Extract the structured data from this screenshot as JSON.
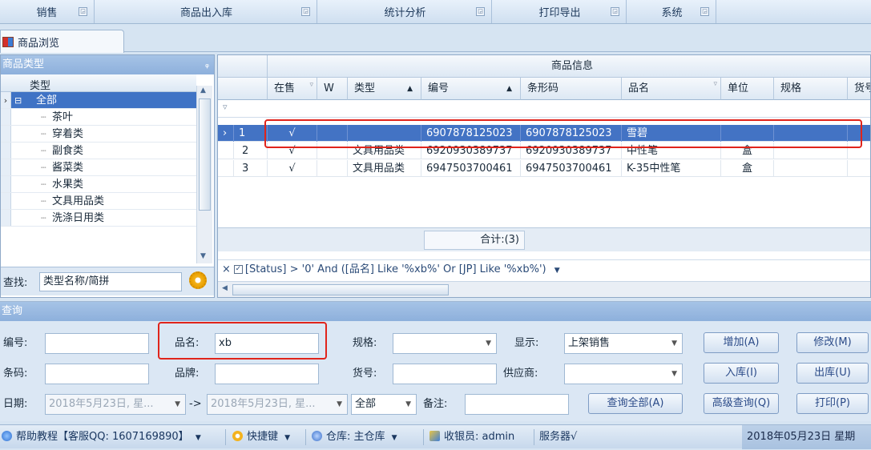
{
  "ribbon": {
    "groups": [
      "销售",
      "商品出入库",
      "统计分析",
      "打印导出",
      "系统"
    ]
  },
  "doc_tab": {
    "label": "商品浏览"
  },
  "category_panel": {
    "title": "商品类型",
    "header": "类型",
    "root": "全部",
    "items": [
      "茶叶",
      "穿着类",
      "副食类",
      "酱菜类",
      "水果类",
      "文具用品类",
      "洗涤日用类"
    ],
    "find_label": "查找:",
    "find_value": "类型名称/简拼"
  },
  "grid": {
    "band_title": "商品信息",
    "columns": [
      "在售",
      "W",
      "类型",
      "编号",
      "条形码",
      "品名",
      "单位",
      "规格",
      "货号"
    ],
    "rows": [
      {
        "no": "1",
        "on_sale": "√",
        "w": "",
        "type": "",
        "code": "6907878125023",
        "barcode": "6907878125023",
        "name": "雪碧",
        "unit": "",
        "spec": ""
      },
      {
        "no": "2",
        "on_sale": "√",
        "w": "",
        "type": "文具用品类",
        "code": "6920930389737",
        "barcode": "6920930389737",
        "name": "中性笔",
        "unit": "盒",
        "spec": ""
      },
      {
        "no": "3",
        "on_sale": "√",
        "w": "",
        "type": "文具用品类",
        "code": "6947503700461",
        "barcode": "6947503700461",
        "name": "K-35中性笔",
        "unit": "盒",
        "spec": ""
      }
    ],
    "total": "合计:(3)",
    "filter_text": "[Status] > '0' And ([品名] Like '%xb%' Or [JP] Like '%xb%')"
  },
  "query": {
    "title": "查询",
    "code_label": "编号:",
    "name_label": "品名:",
    "name_value": "xb",
    "spec_label": "规格:",
    "display_label": "显示:",
    "display_value": "上架销售",
    "barcode_label": "条码:",
    "brand_label": "品牌:",
    "article_label": "货号:",
    "supplier_label": "供应商:",
    "date_label": "日期:",
    "date_from": "2018年5月23日, 星...",
    "arrow": "->",
    "date_to": "2018年5月23日, 星...",
    "range_value": "全部",
    "note_label": "备注:",
    "buttons": {
      "add": "增加(A)",
      "edit": "修改(M)",
      "stock_in": "入库(I)",
      "stock_out": "出库(U)",
      "query_all": "查询全部(A)",
      "advanced": "高级查询(Q)",
      "print": "打印(P)"
    }
  },
  "status": {
    "help": "帮助教程【客服QQ: 1607169890】",
    "shortcut": "快捷键",
    "warehouse": "仓库: 主仓库",
    "cashier": "收银员: admin",
    "server": "服务器√",
    "date": "2018年05月23日 星期"
  }
}
